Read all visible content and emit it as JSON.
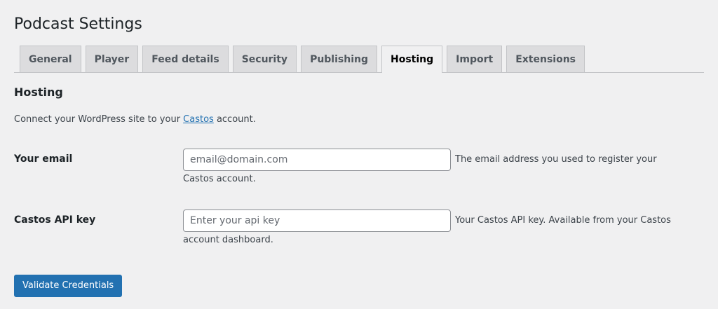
{
  "page_title": "Podcast Settings",
  "tabs": [
    {
      "label": "General"
    },
    {
      "label": "Player"
    },
    {
      "label": "Feed details"
    },
    {
      "label": "Security"
    },
    {
      "label": "Publishing"
    },
    {
      "label": "Hosting",
      "active": true
    },
    {
      "label": "Import"
    },
    {
      "label": "Extensions"
    }
  ],
  "section": {
    "title": "Hosting",
    "intro_before": "Connect your WordPress site to your ",
    "intro_link": "Castos",
    "intro_after": " account."
  },
  "fields": {
    "email": {
      "label": "Your email",
      "value": "",
      "placeholder": "email@domain.com",
      "description": "The email address you used to register your Castos account."
    },
    "api_key": {
      "label": "Castos API key",
      "value": "",
      "placeholder": "Enter your api key",
      "description": "Your Castos API key. Available from your Castos account dashboard."
    }
  },
  "buttons": {
    "validate_label": "Validate Credentials"
  },
  "colors": {
    "accent": "#2271b1",
    "background": "#f0f0f1",
    "tab_inactive": "#dcdcde"
  }
}
